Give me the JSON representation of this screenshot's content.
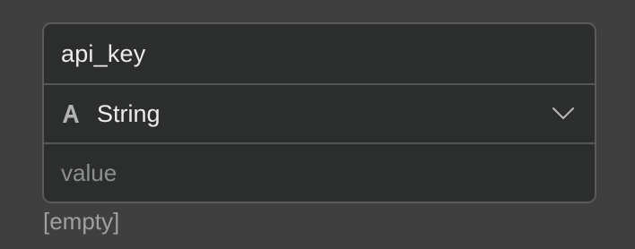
{
  "field": {
    "name_value": "api_key",
    "type": {
      "icon": "text-type-icon",
      "label": "String",
      "expand_icon": "chevron-down-icon"
    },
    "value_placeholder": "value"
  },
  "hint": "[empty]",
  "colors": {
    "background": "#3f3f3f",
    "card_background": "#2c2d2d",
    "border": "#5a5a5a",
    "text": "#ececec",
    "placeholder": "#8d8f90"
  }
}
